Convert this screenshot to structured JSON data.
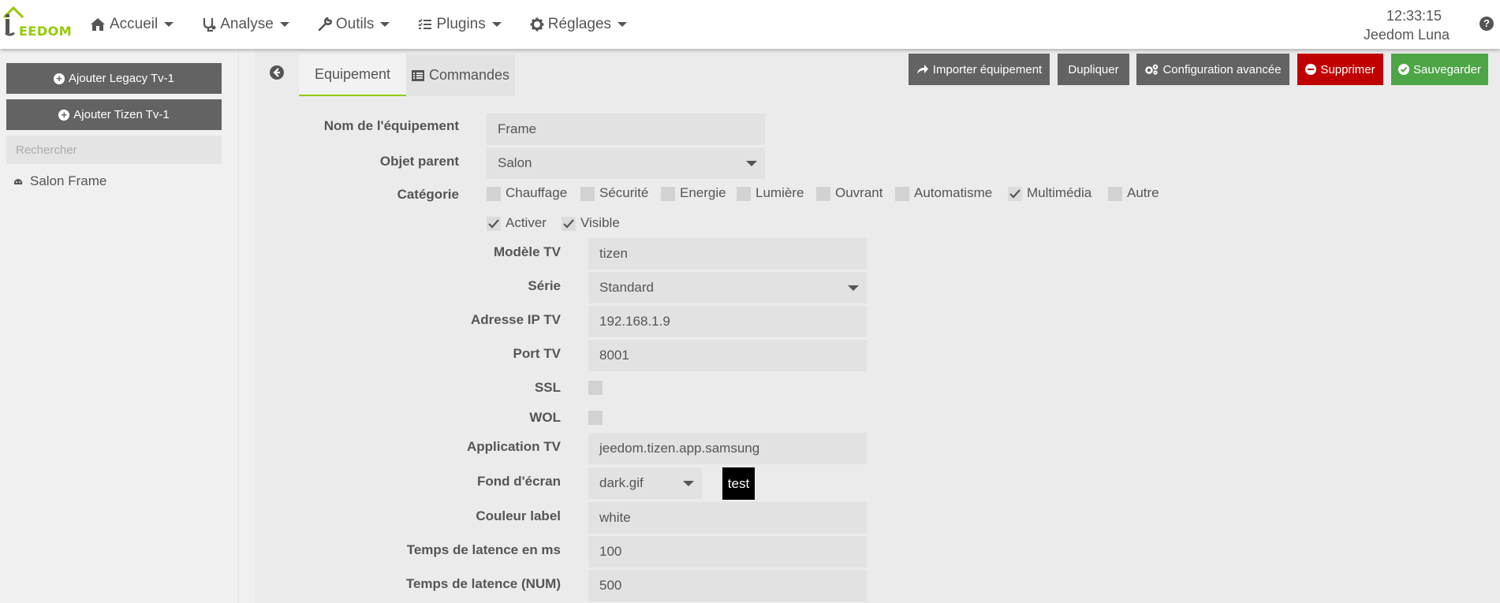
{
  "navbar": {
    "logo_text": "EEDOM",
    "menu": [
      {
        "label": "Accueil",
        "icon": "home-icon"
      },
      {
        "label": "Analyse",
        "icon": "stethoscope-icon"
      },
      {
        "label": "Outils",
        "icon": "wrench-icon"
      },
      {
        "label": "Plugins",
        "icon": "tasks-icon"
      },
      {
        "label": "Réglages",
        "icon": "gear-icon"
      }
    ],
    "time": "12:33:15",
    "user": "Jeedom Luna",
    "help": "?"
  },
  "sidebar": {
    "add_legacy": "Ajouter Legacy Tv-1",
    "add_tizen": "Ajouter Tizen Tv-1",
    "search_placeholder": "Rechercher",
    "items": [
      {
        "label": "Salon Frame",
        "icon": "tv-icon"
      }
    ]
  },
  "tabs": {
    "equipement": "Equipement",
    "commandes": "Commandes"
  },
  "actions": {
    "import": "Importer équipement",
    "duplicate": "Dupliquer",
    "advanced": "Configuration avancée",
    "delete": "Supprimer",
    "save": "Sauvegarder"
  },
  "form": {
    "name_label": "Nom de l'équipement",
    "name_value": "Frame",
    "parent_label": "Objet parent",
    "parent_value": "Salon",
    "category_label": "Catégorie",
    "categories": [
      {
        "label": "Chauffage",
        "checked": false
      },
      {
        "label": "Sécurité",
        "checked": false
      },
      {
        "label": "Energie",
        "checked": false
      },
      {
        "label": "Lumière",
        "checked": false
      },
      {
        "label": "Ouvrant",
        "checked": false
      },
      {
        "label": "Automatisme",
        "checked": false
      },
      {
        "label": "Multimédia",
        "checked": true
      },
      {
        "label": "Autre",
        "checked": false
      }
    ],
    "activer": {
      "label": "Activer",
      "checked": true
    },
    "visible": {
      "label": "Visible",
      "checked": true
    },
    "model_label": "Modèle TV",
    "model_value": "tizen",
    "serie_label": "Série",
    "serie_value": "Standard",
    "ip_label": "Adresse IP TV",
    "ip_value": "192.168.1.9",
    "port_label": "Port TV",
    "port_value": "8001",
    "ssl_label": "SSL",
    "ssl_checked": false,
    "wol_label": "WOL",
    "wol_checked": false,
    "app_label": "Application TV",
    "app_value": "jeedom.tizen.app.samsung",
    "wallpaper_label": "Fond d'écran",
    "wallpaper_value": "dark.gif",
    "wallpaper_preview": "test",
    "color_label": "Couleur label",
    "color_value": "white",
    "latency_label": "Temps de latence en ms",
    "latency_value": "100",
    "latency_num_label": "Temps de latence (NUM)",
    "latency_num_value": "500"
  },
  "colors": {
    "accent": "#93ca02",
    "danger": "#c00000",
    "success": "#4da546",
    "button": "#636363"
  }
}
